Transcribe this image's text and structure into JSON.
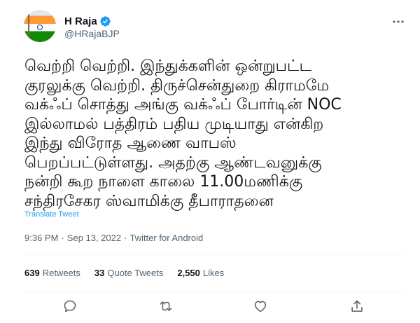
{
  "author": {
    "name": "H Raja",
    "handle": "@HRajaBJP",
    "verified": true,
    "avatar": "indian-flag-avatar"
  },
  "tweet": {
    "lines": [
      "வெற்றி வெற்றி. இந்துக்களின் ஒன்றுபட்ட",
      "குரலுக்கு வெற்றி. திருச்சென்துறை கிராமமே",
      "வக்ஃப் சொத்து அங்கு வக்ஃப் போர்டின் NOC",
      "இல்லாமல் பத்திரம் பதிய முடியாது என்கிற",
      "இந்து விரோத ஆணை வாபஸ்",
      "பெறப்பட்டுள்ளது. அதற்கு ஆண்டவனுக்கு",
      "நன்றி கூற நாளை காலை 11.00மணிக்கு",
      "சந்திரசேகர ஸ்வாமிக்கு தீபாராதனை"
    ],
    "translate_label": "Translate Tweet"
  },
  "meta": {
    "time": "9:36 PM",
    "date": "Sep 13, 2022",
    "source": "Twitter for Android",
    "separator": "·"
  },
  "stats": {
    "retweets": {
      "count": "639",
      "label": "Retweets"
    },
    "quote_tweets": {
      "count": "33",
      "label": "Quote Tweets"
    },
    "likes": {
      "count": "2,550",
      "label": "Likes"
    }
  },
  "actions": [
    {
      "icon": "reply-icon"
    },
    {
      "icon": "retweet-icon"
    },
    {
      "icon": "like-icon"
    },
    {
      "icon": "share-icon"
    }
  ],
  "header_icons": {
    "badge": "verified-badge-icon",
    "more": "more-icon"
  },
  "colors": {
    "text": "#0f1419",
    "secondary": "#536471",
    "accent": "#1d9bf0",
    "divider": "#eff3f4"
  }
}
